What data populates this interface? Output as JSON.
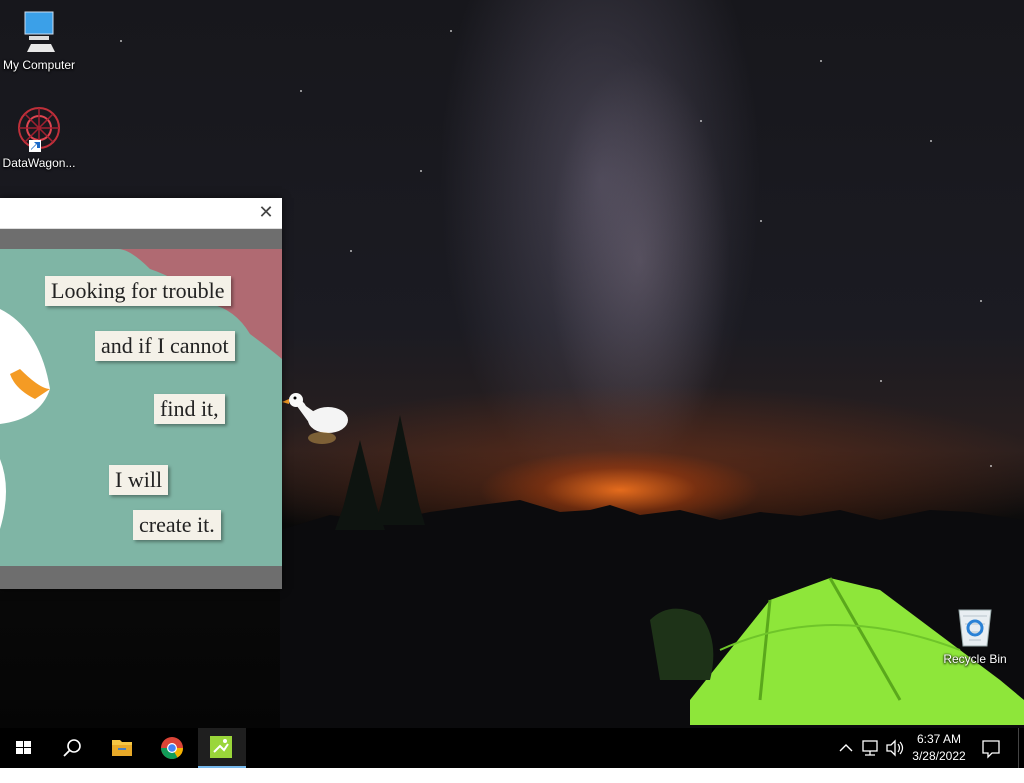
{
  "desktop": {
    "icons": [
      {
        "label": "My Computer",
        "icon": "computer-icon"
      },
      {
        "label": "DataWagon...",
        "icon": "datawagon-shortcut-icon"
      },
      {
        "label": "Recycle Bin",
        "icon": "recycle-bin-icon"
      }
    ]
  },
  "viewer": {
    "close_glyph": "✕",
    "lines": [
      "Looking for trouble",
      "and if I cannot",
      "find it,",
      "I will",
      "create it."
    ]
  },
  "taskbar": {
    "apps": [
      {
        "name": "start",
        "icon": "windows-logo-icon"
      },
      {
        "name": "search",
        "icon": "search-icon"
      },
      {
        "name": "file-explorer",
        "icon": "folder-icon"
      },
      {
        "name": "chrome",
        "icon": "chrome-icon"
      },
      {
        "name": "image-viewer",
        "icon": "image-viewer-icon",
        "active": true
      }
    ],
    "tray": {
      "chevron": "^",
      "time": "6:37 AM",
      "date": "3/28/2022"
    }
  },
  "colors": {
    "taskbar": "#000000",
    "active_indicator": "#76b9ed",
    "tent": "#8ee63a",
    "viewer_bg": "#7fb5a5"
  }
}
